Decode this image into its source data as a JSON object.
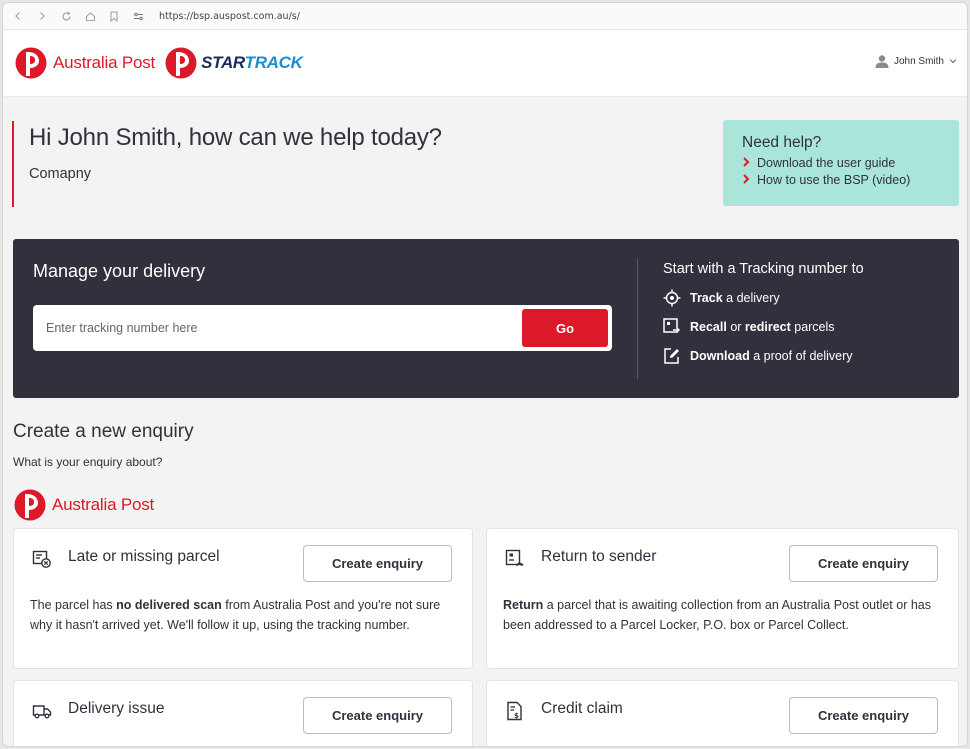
{
  "browser": {
    "url": "https://bsp.auspost.com.au/s/"
  },
  "header": {
    "brand_ap": "Australia Post",
    "brand_st_a": "STAR",
    "brand_st_b": "TRACK",
    "user_name": "John Smith"
  },
  "greeting": {
    "title": "Hi John Smith, how can we help today?",
    "company": "Comapny"
  },
  "help": {
    "title": "Need help?",
    "links": [
      "Download the user guide",
      "How to use the BSP (video)"
    ]
  },
  "manage": {
    "title": "Manage your delivery",
    "placeholder": "Enter tracking number here",
    "go_label": "Go",
    "right_title": "Start with a Tracking number to",
    "features": [
      {
        "bold1": "Track",
        "rest1": " a delivery",
        "bold2": "",
        "rest2": ""
      },
      {
        "bold1": "Recall",
        "rest1": " or ",
        "bold2": "redirect",
        "rest2": " parcels"
      },
      {
        "bold1": "Download",
        "rest1": " a proof of delivery",
        "bold2": "",
        "rest2": ""
      }
    ]
  },
  "enquiry": {
    "title": "Create a new enquiry",
    "subtitle": "What is your enquiry about?",
    "brand": "Australia Post",
    "cards": [
      {
        "title": "Late or missing parcel",
        "button": "Create enquiry",
        "desc_pre": "The parcel has ",
        "desc_bold": "no delivered scan",
        "desc_post": " from Australia Post and you're not sure why it hasn't arrived yet. We'll follow it up, using the tracking number."
      },
      {
        "title": "Return to sender",
        "button": "Create enquiry",
        "desc_pre": "",
        "desc_bold": "Return",
        "desc_post": " a parcel that is awaiting collection from an Australia Post outlet or has been addressed to a Parcel Locker, P.O. box or Parcel Collect."
      },
      {
        "title": "Delivery issue",
        "button": "Create enquiry"
      },
      {
        "title": "Credit claim",
        "button": "Create enquiry"
      }
    ]
  },
  "colors": {
    "brand_red": "#dc1928",
    "dark_panel": "#31313d",
    "help_bg": "#a9e6d9"
  }
}
